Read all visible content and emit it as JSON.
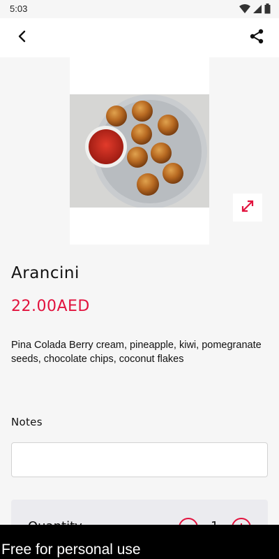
{
  "status_bar": {
    "time": "5:03",
    "icons": [
      "wifi-icon",
      "signal-icon",
      "battery-icon"
    ]
  },
  "app_bar": {
    "back_icon": "chevron-left-icon",
    "share_icon": "share-icon"
  },
  "dish": {
    "image_alt": "Arancini",
    "expand_icon": "expand-icon",
    "title": "Arancini",
    "price": "22.00AED",
    "description": "Pina Colada Berry cream, pineapple, kiwi, pomegranate seeds, chocolate chips, coconut flakes"
  },
  "notes": {
    "label": "Notes",
    "value": "",
    "placeholder": ""
  },
  "quantity": {
    "label": "Quantity",
    "value": "1"
  },
  "watermark": {
    "text": "Free for personal use"
  },
  "colors": {
    "accent": "#e2133e",
    "background": "#f6f6f6",
    "card": "#ebebef"
  }
}
